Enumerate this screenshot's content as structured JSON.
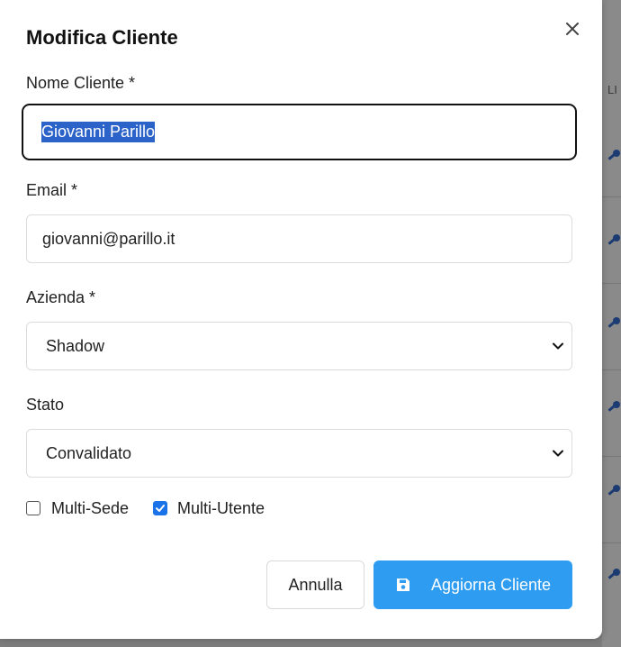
{
  "modal": {
    "title": "Modifica Cliente",
    "close_icon": "close-icon"
  },
  "fields": {
    "name": {
      "label": "Nome Cliente *",
      "value": "Giovanni Parillo"
    },
    "email": {
      "label": "Email *",
      "value": "giovanni@parillo.it"
    },
    "company": {
      "label": "Azienda *",
      "value": "Shadow"
    },
    "status": {
      "label": "Stato",
      "value": "Convalidato"
    }
  },
  "options": {
    "multi_sede": {
      "label": "Multi-Sede",
      "checked": false
    },
    "multi_utente": {
      "label": "Multi-Utente",
      "checked": true
    }
  },
  "buttons": {
    "cancel": "Annulla",
    "submit": "Aggiorna Cliente",
    "submit_icon": "save-icon"
  },
  "background": {
    "header_fragment": "LI",
    "row_icon": "key-icon"
  },
  "colors": {
    "primary": "#2e9cf0",
    "checkbox_checked": "#1a73e8",
    "selection": "#2b63c9",
    "overlay": "#7d7d7d"
  }
}
